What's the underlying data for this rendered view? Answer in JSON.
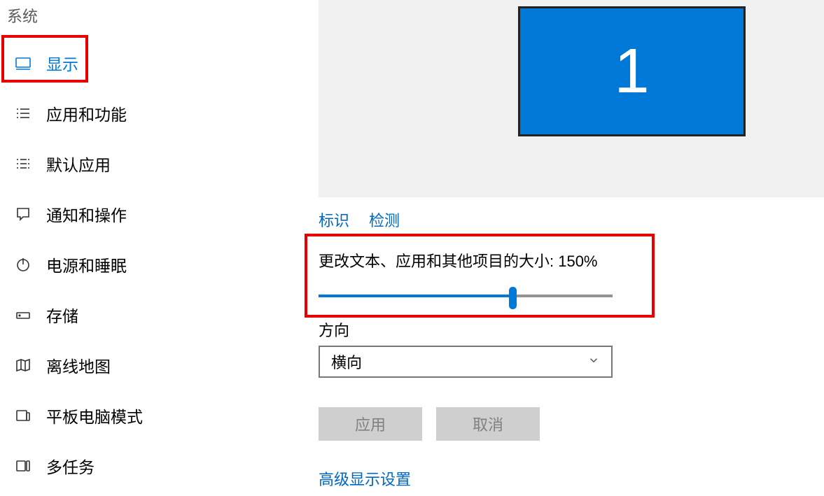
{
  "sidebar": {
    "title": "系统",
    "items": [
      {
        "label": "显示"
      },
      {
        "label": "应用和功能"
      },
      {
        "label": "默认应用"
      },
      {
        "label": "通知和操作"
      },
      {
        "label": "电源和睡眠"
      },
      {
        "label": "存储"
      },
      {
        "label": "离线地图"
      },
      {
        "label": "平板电脑模式"
      },
      {
        "label": "多任务"
      }
    ]
  },
  "monitor": {
    "number": "1"
  },
  "links": {
    "identify": "标识",
    "detect": "检测"
  },
  "scaling": {
    "label": "更改文本、应用和其他项目的大小: 150%",
    "percent": 150,
    "slider_pos_pct": 66
  },
  "orientation": {
    "label": "方向",
    "value": "横向"
  },
  "buttons": {
    "apply": "应用",
    "cancel": "取消"
  },
  "advanced_link": "高级显示设置"
}
